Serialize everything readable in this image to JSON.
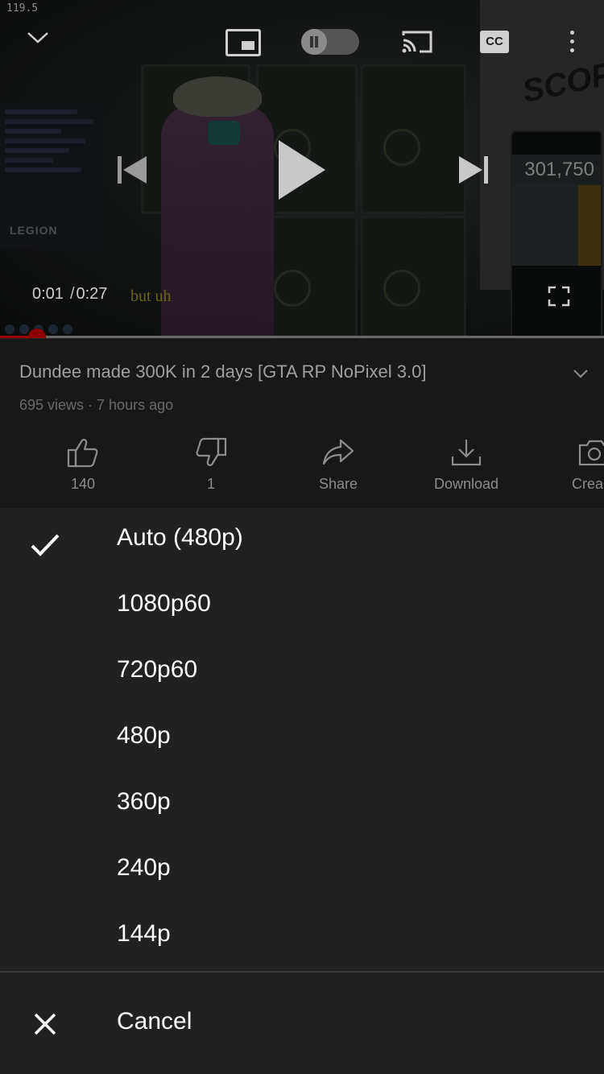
{
  "status": {
    "time": "119.5"
  },
  "player": {
    "current_time": "0:01",
    "separator": "/",
    "duration": "0:27",
    "caption_text": "but uh",
    "progress_fraction": 0.0617,
    "calculator_display": "301,750",
    "board_text": "SCOPE",
    "overlay_brand": "LEGION",
    "cc_label": "CC"
  },
  "video": {
    "title": "Dundee made 300K in 2 days [GTA RP NoPixel 3.0]",
    "meta": "695 views · 7 hours ago"
  },
  "actions": [
    {
      "icon": "thumbs-up-icon",
      "label": "140"
    },
    {
      "icon": "thumbs-down-icon",
      "label": "1"
    },
    {
      "icon": "share-icon",
      "label": "Share"
    },
    {
      "icon": "download-icon",
      "label": "Download"
    },
    {
      "icon": "create-icon",
      "label": "Crea"
    }
  ],
  "quality_menu": {
    "selected": "Auto (480p)",
    "options": [
      "Auto (480p)",
      "1080p60",
      "720p60",
      "480p",
      "360p",
      "240p",
      "144p"
    ],
    "cancel_label": "Cancel"
  },
  "colors": {
    "progress_played": "#a40000",
    "sheet_bg": "#212121",
    "info_bg": "#181818"
  }
}
